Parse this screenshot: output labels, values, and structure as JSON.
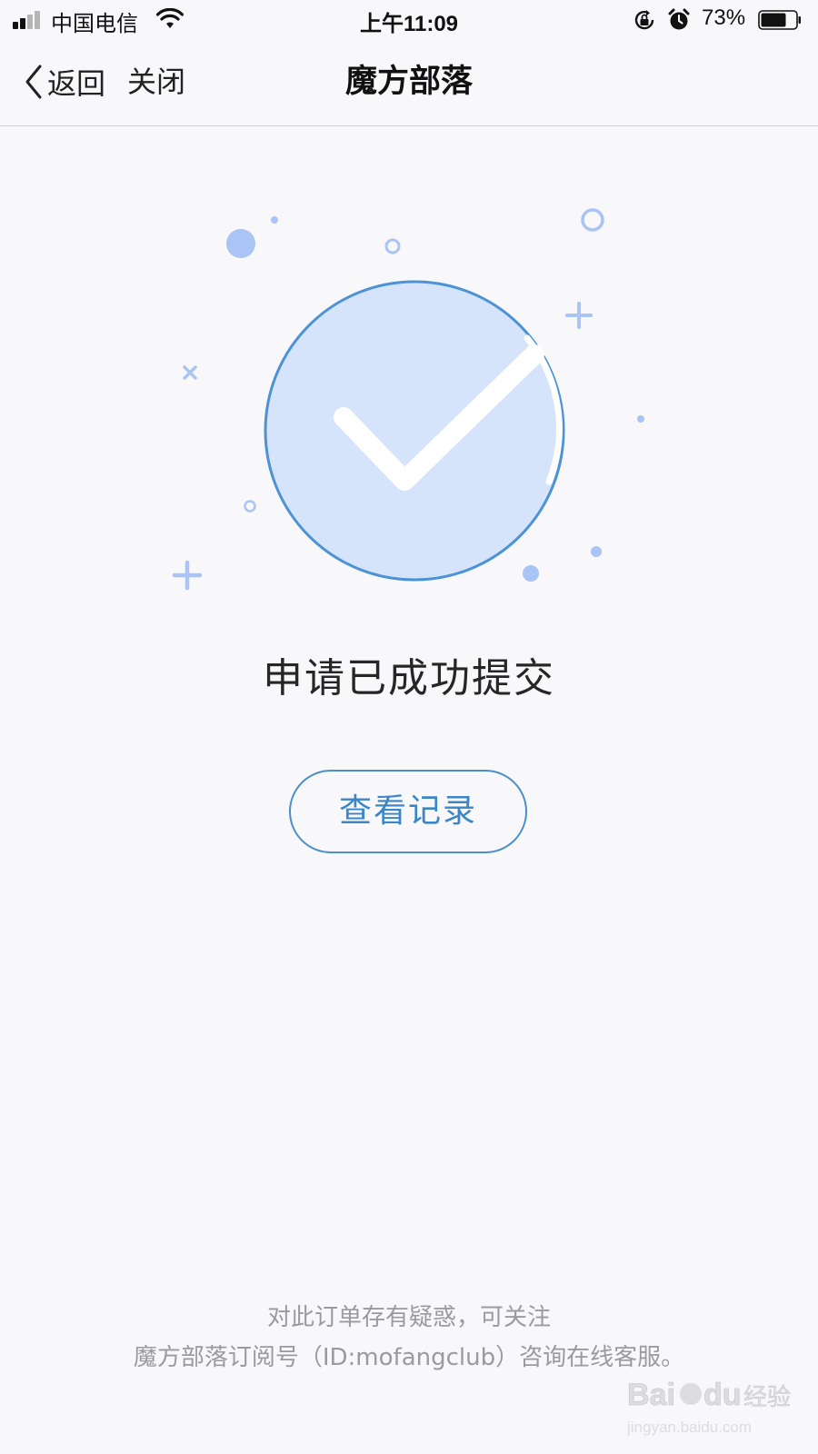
{
  "status_bar": {
    "carrier": "中国电信",
    "time": "上午11:09",
    "battery_percent": "73%",
    "battery_level": 0.73,
    "icons": [
      "signal-icon",
      "wifi-icon",
      "rotation-lock-icon",
      "alarm-icon",
      "battery-icon"
    ]
  },
  "nav": {
    "back_label": "返回",
    "close_label": "关闭",
    "title": "魔方部落"
  },
  "main": {
    "illustration_icon": "check-circle-icon",
    "success_message": "申请已成功提交",
    "view_records_label": "查看记录"
  },
  "footer": {
    "line1": "对此订单存有疑惑，可关注",
    "line2": "魔方部落订阅号（ID:mofangclub）咨询在线客服。"
  },
  "watermark": {
    "brand": "Baidu经验",
    "url": "jingyan.baidu.com"
  },
  "colors": {
    "accent": "#3a86c8",
    "circle_fill": "#d6e4fb",
    "circle_stroke": "#4b93d6",
    "decor": "#a9c4f5",
    "background": "#f8f7fa"
  }
}
